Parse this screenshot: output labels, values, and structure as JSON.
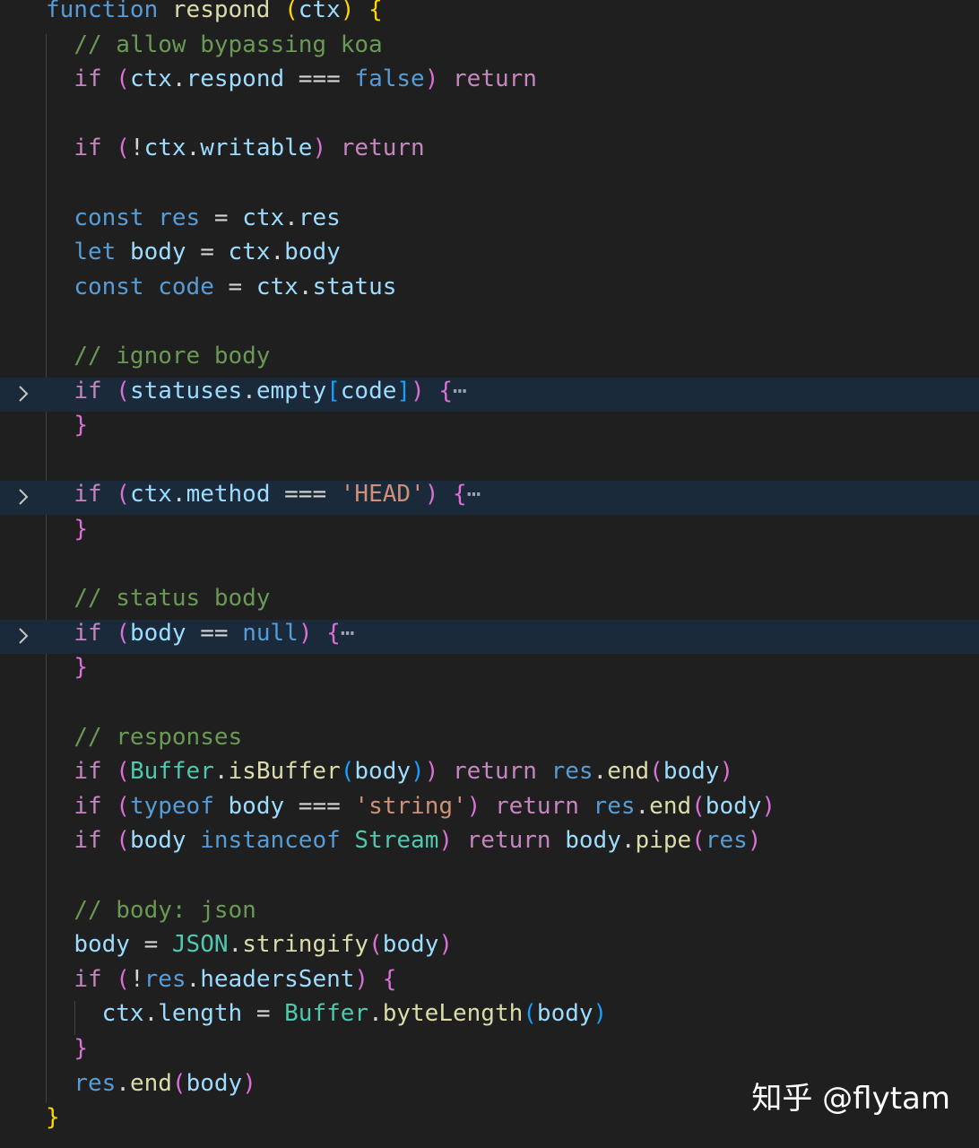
{
  "editor": {
    "language": "javascript",
    "folded_lines": [
      11,
      14,
      18
    ],
    "lines": [
      [
        [
          "kw-decl",
          "function"
        ],
        [
          "plain",
          " "
        ],
        [
          "fn",
          "respond"
        ],
        [
          "plain",
          " "
        ],
        [
          "brace",
          "("
        ],
        [
          "var",
          "ctx"
        ],
        [
          "brace",
          ")"
        ],
        [
          "plain",
          " "
        ],
        [
          "brace",
          "{"
        ]
      ],
      [
        [
          "plain",
          "  "
        ],
        [
          "cmt",
          "// allow bypassing koa"
        ]
      ],
      [
        [
          "plain",
          "  "
        ],
        [
          "ctl",
          "if"
        ],
        [
          "plain",
          " "
        ],
        [
          "paren",
          "("
        ],
        [
          "var",
          "ctx"
        ],
        [
          "plain",
          "."
        ],
        [
          "var",
          "respond"
        ],
        [
          "plain",
          " === "
        ],
        [
          "lit",
          "false"
        ],
        [
          "paren",
          ")"
        ],
        [
          "plain",
          " "
        ],
        [
          "ctl",
          "return"
        ]
      ],
      [],
      [
        [
          "plain",
          "  "
        ],
        [
          "ctl",
          "if"
        ],
        [
          "plain",
          " "
        ],
        [
          "paren",
          "("
        ],
        [
          "plain",
          "!"
        ],
        [
          "var",
          "ctx"
        ],
        [
          "plain",
          "."
        ],
        [
          "var",
          "writable"
        ],
        [
          "paren",
          ")"
        ],
        [
          "plain",
          " "
        ],
        [
          "ctl",
          "return"
        ]
      ],
      [],
      [
        [
          "plain",
          "  "
        ],
        [
          "kw-decl",
          "const"
        ],
        [
          "plain",
          " "
        ],
        [
          "lit",
          "res"
        ],
        [
          "plain",
          " = "
        ],
        [
          "var",
          "ctx"
        ],
        [
          "plain",
          "."
        ],
        [
          "var",
          "res"
        ]
      ],
      [
        [
          "plain",
          "  "
        ],
        [
          "kw-decl",
          "let"
        ],
        [
          "plain",
          " "
        ],
        [
          "var",
          "body"
        ],
        [
          "plain",
          " = "
        ],
        [
          "var",
          "ctx"
        ],
        [
          "plain",
          "."
        ],
        [
          "var",
          "body"
        ]
      ],
      [
        [
          "plain",
          "  "
        ],
        [
          "kw-decl",
          "const"
        ],
        [
          "plain",
          " "
        ],
        [
          "lit",
          "code"
        ],
        [
          "plain",
          " = "
        ],
        [
          "var",
          "ctx"
        ],
        [
          "plain",
          "."
        ],
        [
          "var",
          "status"
        ]
      ],
      [],
      [
        [
          "plain",
          "  "
        ],
        [
          "cmt",
          "// ignore body"
        ]
      ],
      [
        [
          "plain",
          "  "
        ],
        [
          "ctl",
          "if"
        ],
        [
          "plain",
          " "
        ],
        [
          "paren",
          "("
        ],
        [
          "var",
          "statuses"
        ],
        [
          "plain",
          "."
        ],
        [
          "var",
          "empty"
        ],
        [
          "brack",
          "["
        ],
        [
          "var",
          "code"
        ],
        [
          "brack",
          "]"
        ],
        [
          "paren",
          ")"
        ],
        [
          "plain",
          " "
        ],
        [
          "paren",
          "{"
        ],
        [
          "ellipsis",
          "⋯"
        ]
      ],
      [
        [
          "plain",
          "  "
        ],
        [
          "paren",
          "}"
        ]
      ],
      [],
      [
        [
          "plain",
          "  "
        ],
        [
          "ctl",
          "if"
        ],
        [
          "plain",
          " "
        ],
        [
          "paren",
          "("
        ],
        [
          "var",
          "ctx"
        ],
        [
          "plain",
          "."
        ],
        [
          "var",
          "method"
        ],
        [
          "plain",
          " === "
        ],
        [
          "str",
          "'HEAD'"
        ],
        [
          "paren",
          ")"
        ],
        [
          "plain",
          " "
        ],
        [
          "paren",
          "{"
        ],
        [
          "ellipsis",
          "⋯"
        ]
      ],
      [
        [
          "plain",
          "  "
        ],
        [
          "paren",
          "}"
        ]
      ],
      [],
      [
        [
          "plain",
          "  "
        ],
        [
          "cmt",
          "// status body"
        ]
      ],
      [
        [
          "plain",
          "  "
        ],
        [
          "ctl",
          "if"
        ],
        [
          "plain",
          " "
        ],
        [
          "paren",
          "("
        ],
        [
          "var",
          "body"
        ],
        [
          "plain",
          " == "
        ],
        [
          "lit",
          "null"
        ],
        [
          "paren",
          ")"
        ],
        [
          "plain",
          " "
        ],
        [
          "paren",
          "{"
        ],
        [
          "ellipsis",
          "⋯"
        ]
      ],
      [
        [
          "plain",
          "  "
        ],
        [
          "paren",
          "}"
        ]
      ],
      [],
      [
        [
          "plain",
          "  "
        ],
        [
          "cmt",
          "// responses"
        ]
      ],
      [
        [
          "plain",
          "  "
        ],
        [
          "ctl",
          "if"
        ],
        [
          "plain",
          " "
        ],
        [
          "paren",
          "("
        ],
        [
          "type",
          "Buffer"
        ],
        [
          "plain",
          "."
        ],
        [
          "fn",
          "isBuffer"
        ],
        [
          "brack",
          "("
        ],
        [
          "var",
          "body"
        ],
        [
          "brack",
          ")"
        ],
        [
          "paren",
          ")"
        ],
        [
          "plain",
          " "
        ],
        [
          "ctl",
          "return"
        ],
        [
          "plain",
          " "
        ],
        [
          "lit",
          "res"
        ],
        [
          "plain",
          "."
        ],
        [
          "fn",
          "end"
        ],
        [
          "paren",
          "("
        ],
        [
          "var",
          "body"
        ],
        [
          "paren",
          ")"
        ]
      ],
      [
        [
          "plain",
          "  "
        ],
        [
          "ctl",
          "if"
        ],
        [
          "plain",
          " "
        ],
        [
          "paren",
          "("
        ],
        [
          "lit",
          "typeof"
        ],
        [
          "plain",
          " "
        ],
        [
          "var",
          "body"
        ],
        [
          "plain",
          " === "
        ],
        [
          "str",
          "'string'"
        ],
        [
          "paren",
          ")"
        ],
        [
          "plain",
          " "
        ],
        [
          "ctl",
          "return"
        ],
        [
          "plain",
          " "
        ],
        [
          "lit",
          "res"
        ],
        [
          "plain",
          "."
        ],
        [
          "fn",
          "end"
        ],
        [
          "paren",
          "("
        ],
        [
          "var",
          "body"
        ],
        [
          "paren",
          ")"
        ]
      ],
      [
        [
          "plain",
          "  "
        ],
        [
          "ctl",
          "if"
        ],
        [
          "plain",
          " "
        ],
        [
          "paren",
          "("
        ],
        [
          "var",
          "body"
        ],
        [
          "plain",
          " "
        ],
        [
          "lit",
          "instanceof"
        ],
        [
          "plain",
          " "
        ],
        [
          "type",
          "Stream"
        ],
        [
          "paren",
          ")"
        ],
        [
          "plain",
          " "
        ],
        [
          "ctl",
          "return"
        ],
        [
          "plain",
          " "
        ],
        [
          "var",
          "body"
        ],
        [
          "plain",
          "."
        ],
        [
          "fn",
          "pipe"
        ],
        [
          "paren",
          "("
        ],
        [
          "lit",
          "res"
        ],
        [
          "paren",
          ")"
        ]
      ],
      [],
      [
        [
          "plain",
          "  "
        ],
        [
          "cmt",
          "// body: json"
        ]
      ],
      [
        [
          "plain",
          "  "
        ],
        [
          "var",
          "body"
        ],
        [
          "plain",
          " = "
        ],
        [
          "type",
          "JSON"
        ],
        [
          "plain",
          "."
        ],
        [
          "fn",
          "stringify"
        ],
        [
          "paren",
          "("
        ],
        [
          "var",
          "body"
        ],
        [
          "paren",
          ")"
        ]
      ],
      [
        [
          "plain",
          "  "
        ],
        [
          "ctl",
          "if"
        ],
        [
          "plain",
          " "
        ],
        [
          "paren",
          "("
        ],
        [
          "plain",
          "!"
        ],
        [
          "lit",
          "res"
        ],
        [
          "plain",
          "."
        ],
        [
          "var",
          "headersSent"
        ],
        [
          "paren",
          ")"
        ],
        [
          "plain",
          " "
        ],
        [
          "paren",
          "{"
        ]
      ],
      [
        [
          "plain",
          "    "
        ],
        [
          "var",
          "ctx"
        ],
        [
          "plain",
          "."
        ],
        [
          "var",
          "length"
        ],
        [
          "plain",
          " = "
        ],
        [
          "type",
          "Buffer"
        ],
        [
          "plain",
          "."
        ],
        [
          "fn",
          "byteLength"
        ],
        [
          "brack",
          "("
        ],
        [
          "var",
          "body"
        ],
        [
          "brack",
          ")"
        ]
      ],
      [
        [
          "plain",
          "  "
        ],
        [
          "paren",
          "}"
        ]
      ],
      [
        [
          "plain",
          "  "
        ],
        [
          "lit",
          "res"
        ],
        [
          "plain",
          "."
        ],
        [
          "fn",
          "end"
        ],
        [
          "paren",
          "("
        ],
        [
          "var",
          "body"
        ],
        [
          "paren",
          ")"
        ]
      ],
      [
        [
          "brace",
          "}"
        ]
      ]
    ]
  },
  "watermark": {
    "text": "知乎 @flytam"
  },
  "icons": {
    "fold": "chevron-right-icon"
  }
}
